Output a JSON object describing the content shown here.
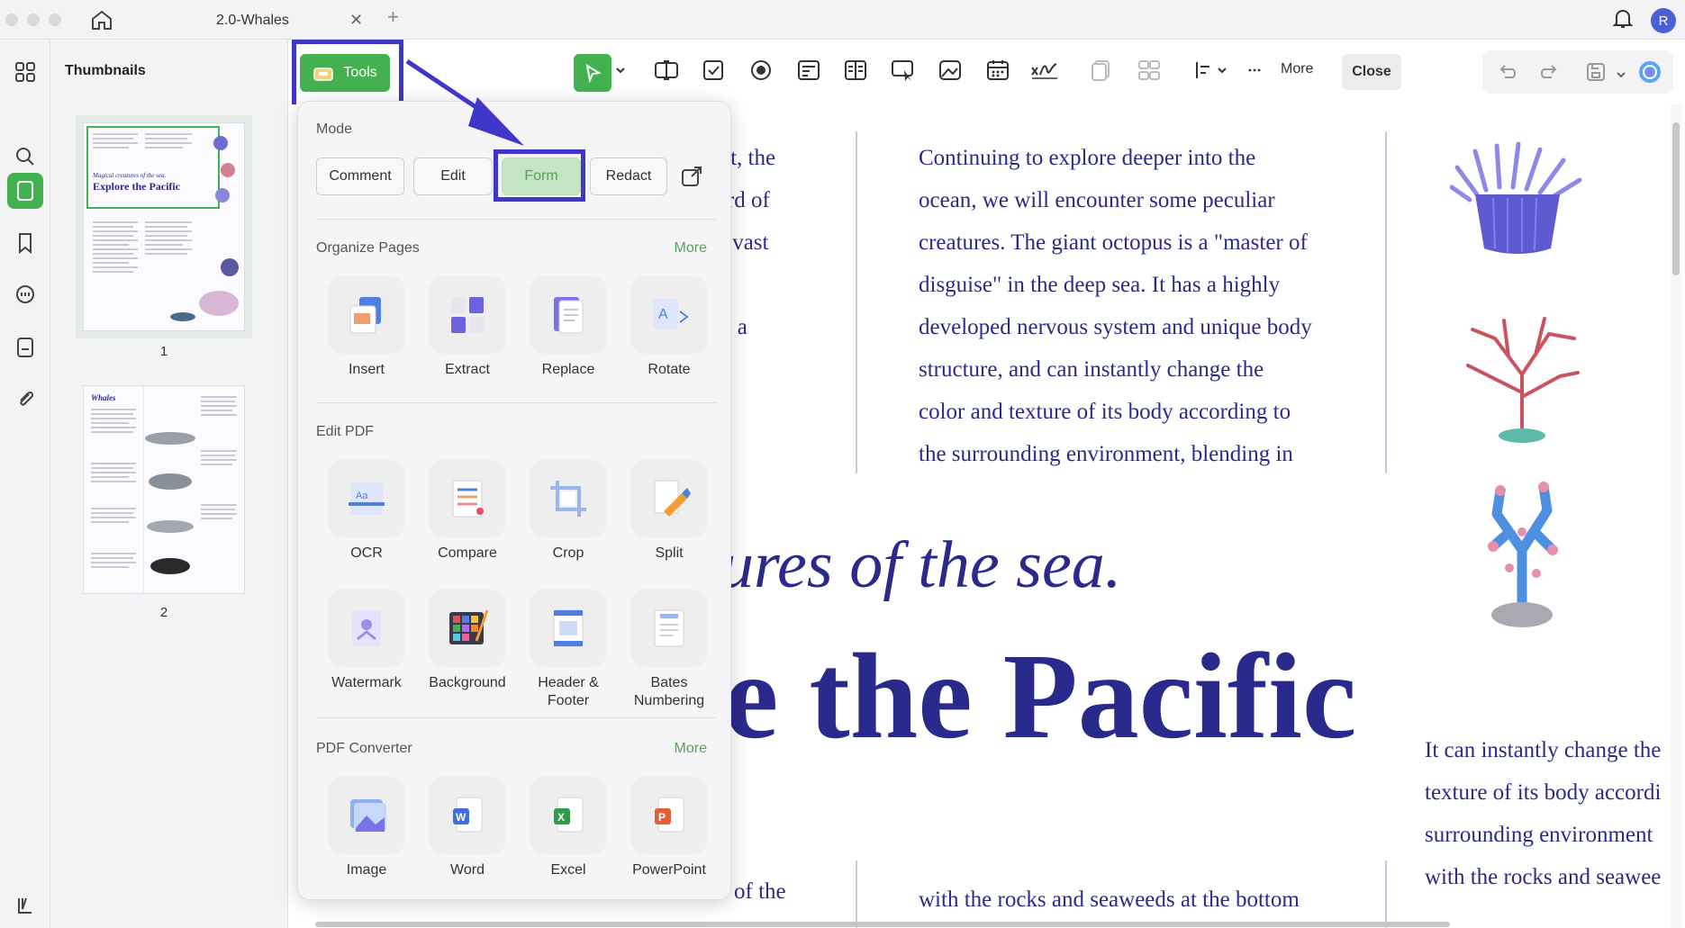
{
  "tab": {
    "title": "2.0-Whales"
  },
  "user": {
    "avatar_initial": "R"
  },
  "thumbnails": {
    "title": "Thumbnails",
    "pages": [
      {
        "number": "1",
        "heading_small": "Magical creatures of the sea.",
        "heading": "Explore the Pacific"
      },
      {
        "number": "2",
        "heading": "Whales"
      }
    ]
  },
  "toolbar": {
    "tools_label": "Tools",
    "more_label": "More",
    "close_label": "Close"
  },
  "popover": {
    "mode_title": "Mode",
    "modes": [
      "Comment",
      "Edit",
      "Form",
      "Redact"
    ],
    "organize": {
      "title": "Organize Pages",
      "more": "More",
      "items": [
        "Insert",
        "Extract",
        "Replace",
        "Rotate"
      ]
    },
    "edit": {
      "title": "Edit PDF",
      "row1": [
        "OCR",
        "Compare",
        "Crop",
        "Split"
      ],
      "row2": [
        "Watermark",
        "Background",
        "Header & Footer",
        "Bates Numbering"
      ]
    },
    "converter": {
      "title": "PDF Converter",
      "more": "More",
      "items": [
        "Image",
        "Word",
        "Excel",
        "PowerPoint"
      ]
    }
  },
  "document": {
    "left_col": [
      "et, the",
      "ird of",
      "l vast",
      "",
      "g a"
    ],
    "middle_col": [
      "Continuing to explore deeper into the",
      "ocean, we will encounter some peculiar",
      "creatures. The giant octopus is a \"master of",
      "disguise\" in the deep sea. It has a highly",
      "developed nervous system and unique body",
      "structure, and can instantly change the",
      "color and texture of its body according to",
      "the surrounding environment, blending in"
    ],
    "big_italic": "ures of the sea.",
    "big_bold": "e the Pacific",
    "right_col": [
      "It can instantly change the",
      "texture of its body accordi",
      "surrounding environment",
      "with the rocks and seawee"
    ],
    "bottom_left": "of the",
    "bottom_middle": "with the rocks and seaweeds at the bottom"
  },
  "colors": {
    "accent": "#43b14f",
    "highlight": "#3e37c8",
    "doc_text": "#2a2a8c"
  }
}
